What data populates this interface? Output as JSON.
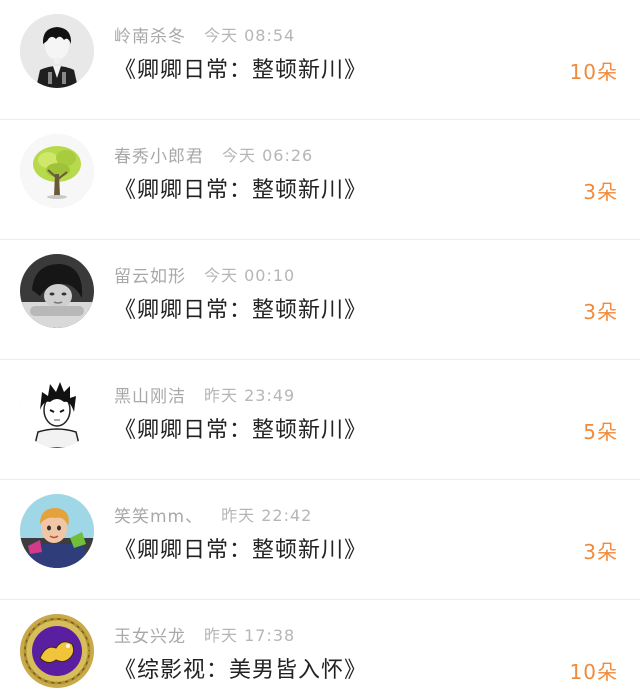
{
  "items": [
    {
      "username": "岭南杀冬",
      "time": "今天 08:54",
      "title": "《卿卿日常：整顿新川》",
      "count": "10朵",
      "avatar_icon": "avatar-boy-icon"
    },
    {
      "username": "春秀小郎君",
      "time": "今天 06:26",
      "title": "《卿卿日常：整顿新川》",
      "count": "3朵",
      "avatar_icon": "tree-icon"
    },
    {
      "username": "留云如形",
      "time": "今天 00:10",
      "title": "《卿卿日常：整顿新川》",
      "count": "3朵",
      "avatar_icon": "avatar-girl-icon"
    },
    {
      "username": "黑山刚洁",
      "time": "昨天 23:49",
      "title": "《卿卿日常：整顿新川》",
      "count": "5朵",
      "avatar_icon": "avatar-anime-boy-icon"
    },
    {
      "username": "笑笑mm、",
      "time": "昨天 22:42",
      "title": "《卿卿日常：整顿新川》",
      "count": "3朵",
      "avatar_icon": "avatar-kid-icon"
    },
    {
      "username": "玉女兴龙",
      "time": "昨天 17:38",
      "title": "《综影视：美男皆入怀》",
      "count": "10朵",
      "avatar_icon": "avatar-emblem-icon"
    }
  ],
  "colors": {
    "count": "#f08a3c",
    "divider": "#ededed",
    "meta": "#a8a8a8",
    "title": "#222222"
  }
}
